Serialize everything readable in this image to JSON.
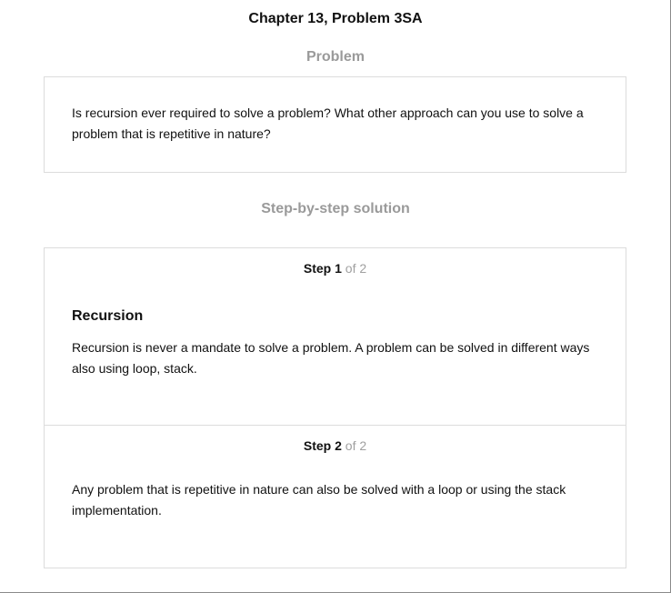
{
  "page": {
    "title": "Chapter 13, Problem 3SA"
  },
  "problem": {
    "heading": "Problem",
    "text": "Is recursion ever required to solve a problem? What other approach can you use to solve a problem that is repetitive in nature?"
  },
  "solution": {
    "heading": "Step-by-step solution",
    "steps": [
      {
        "word": "Step",
        "number": "1",
        "of": "of 2",
        "title": "Recursion",
        "text": "Recursion is never a mandate to solve a problem. A problem can be solved in different ways also using loop, stack."
      },
      {
        "word": "Step",
        "number": "2",
        "of": "of 2",
        "title": "",
        "text": "Any problem that is repetitive in nature can also be solved with a loop or using the stack implementation."
      }
    ]
  },
  "colors": {
    "heading_gray": "#9a9a9a",
    "border": "#dcdcdc",
    "muted": "#a0a0a0"
  }
}
